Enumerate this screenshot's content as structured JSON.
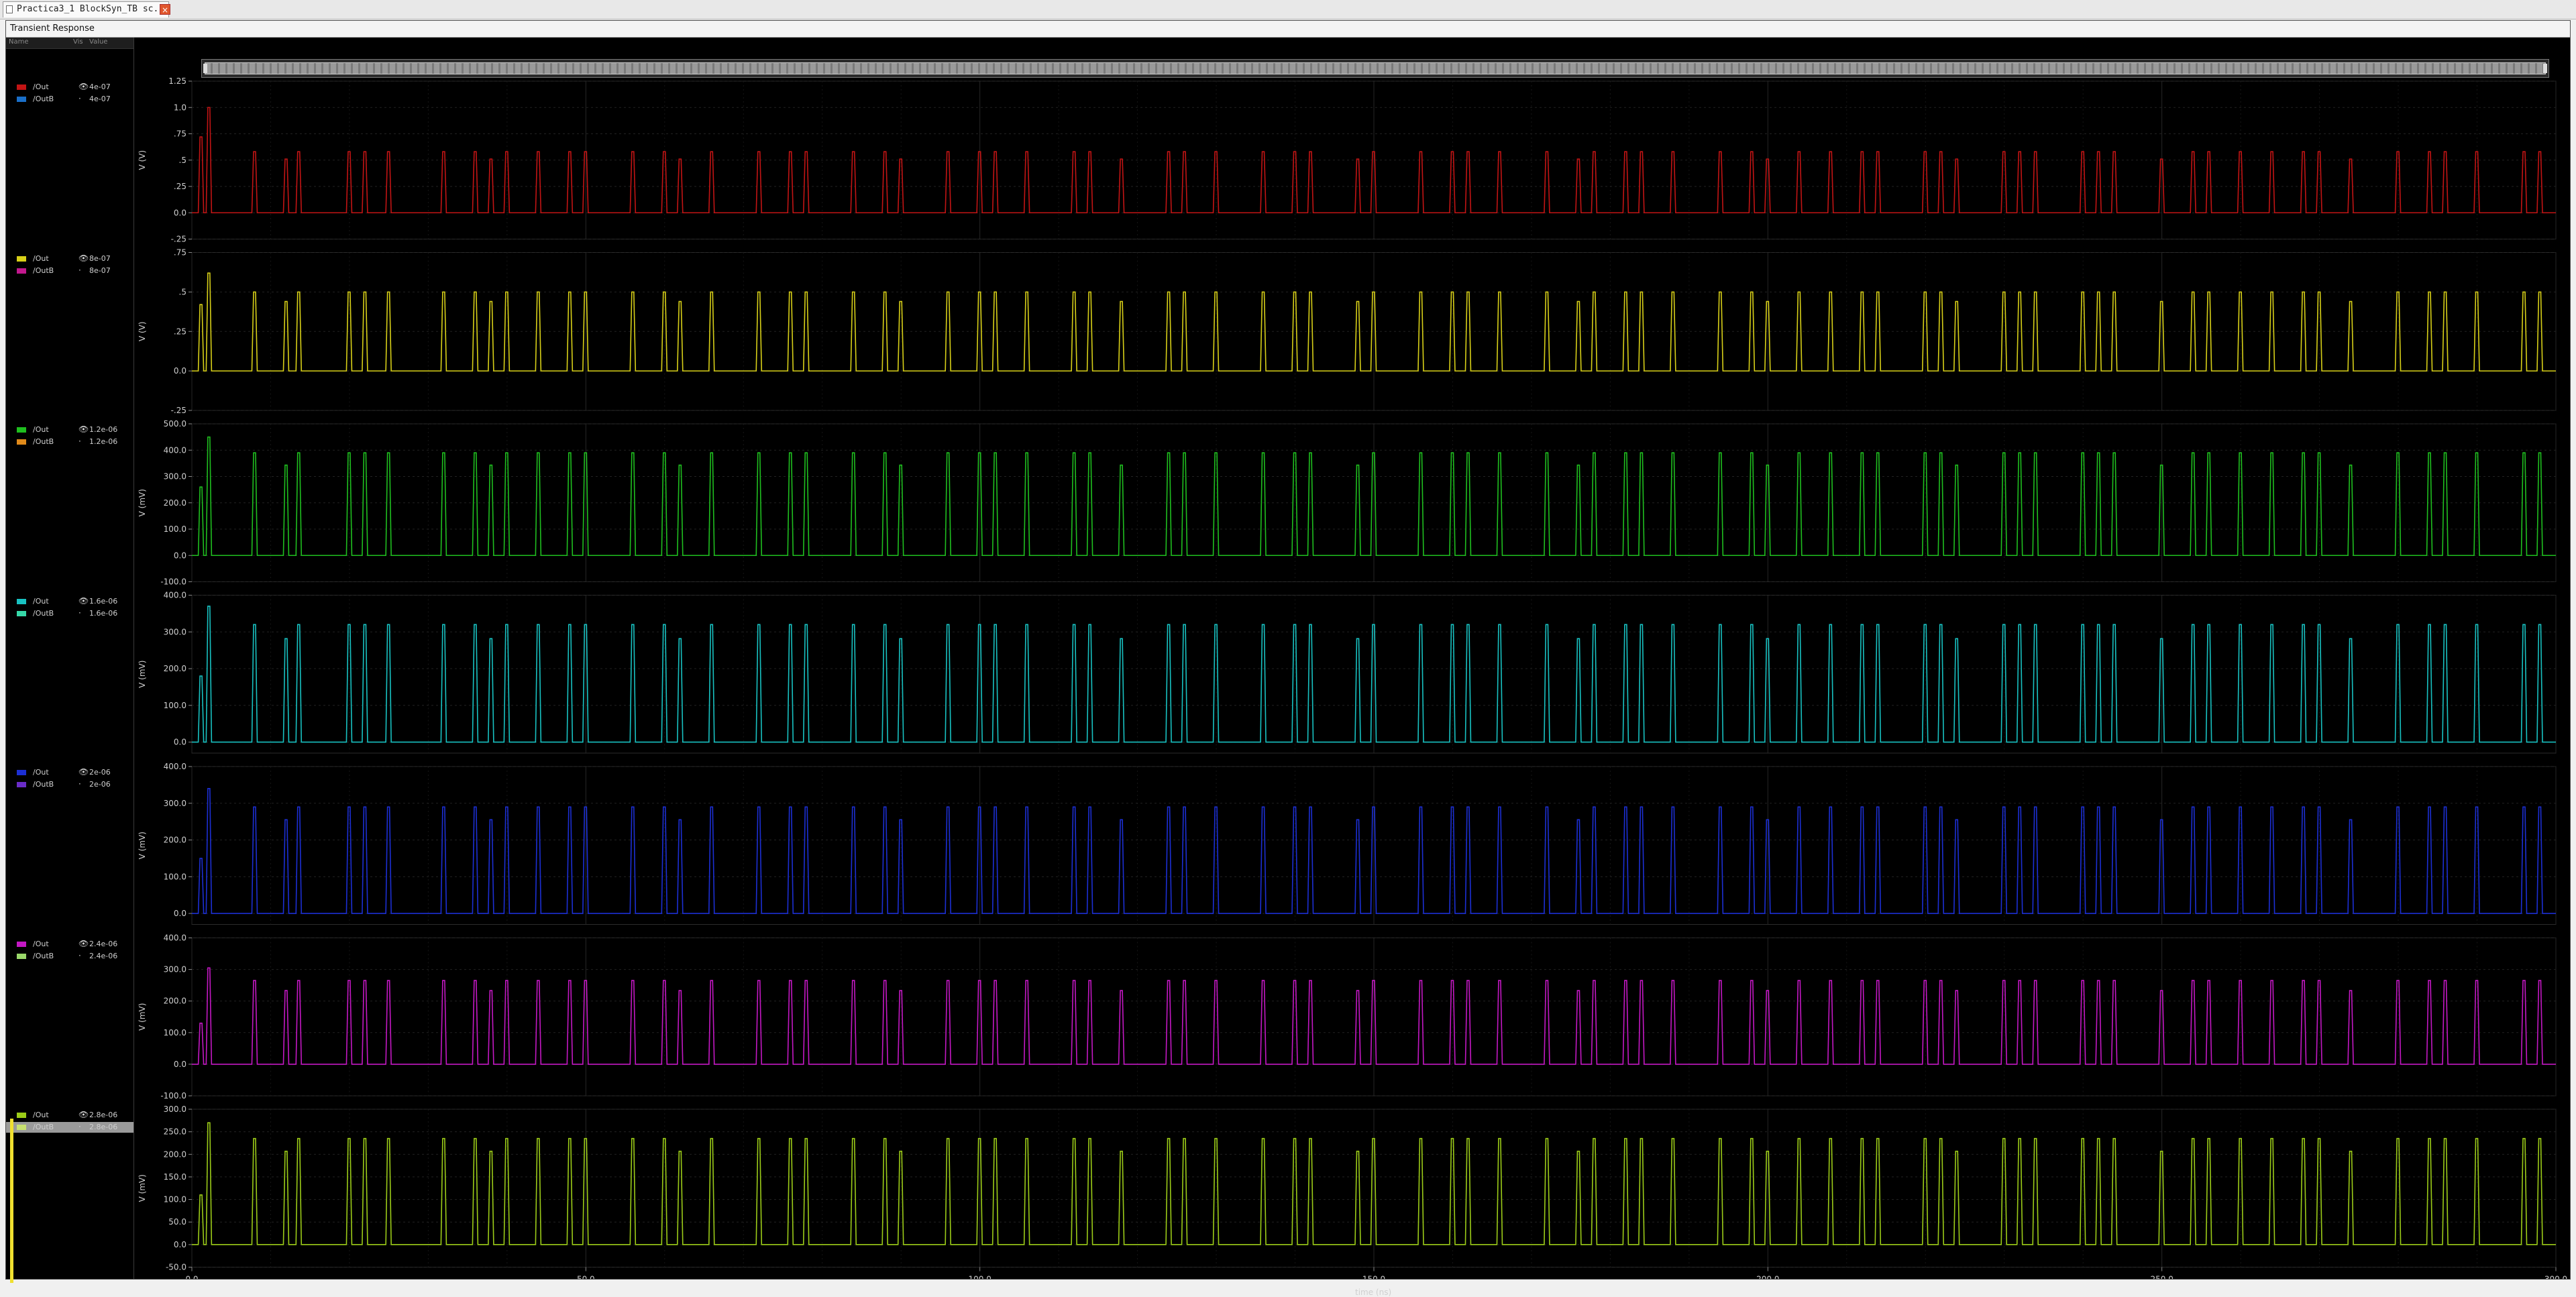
{
  "tab": {
    "label": "Practica3_1 BlockSyn_TB sc...",
    "close_glyph": "×"
  },
  "window": {
    "title": "Transient Response"
  },
  "legend_header": {
    "name_col": "Name",
    "vis_col": "Vis",
    "value_col": "Value"
  },
  "panels": [
    {
      "color": "#c21414",
      "traces": [
        {
          "name": "/Out",
          "value": "4e-07",
          "color": "#c21414",
          "eye": true
        },
        {
          "name": "/OutB",
          "value": "4e-07",
          "color": "#1a6fc9",
          "eye": false
        }
      ],
      "yunit": "V (V)",
      "ylim": [
        -0.25,
        1.25
      ],
      "yticks": [
        "1.25",
        "1.0",
        ".75",
        ".5",
        ".25",
        "0.0",
        "-.25"
      ],
      "tickvals": [
        1.25,
        1.0,
        0.75,
        0.5,
        0.25,
        0.0,
        -0.25
      ],
      "peak": 0.58,
      "first_peaks": [
        0.72,
        1.0
      ]
    },
    {
      "color": "#d8d018",
      "traces": [
        {
          "name": "/Out",
          "value": "8e-07",
          "color": "#d8d018",
          "eye": true
        },
        {
          "name": "/OutB",
          "value": "8e-07",
          "color": "#c2188e",
          "eye": false
        }
      ],
      "yunit": "V (V)",
      "ylim": [
        -0.25,
        0.75
      ],
      "yticks": [
        ".75",
        ".5",
        ".25",
        "0.0",
        "-.25"
      ],
      "tickvals": [
        0.75,
        0.5,
        0.25,
        0.0,
        -0.25
      ],
      "peak": 0.5,
      "first_peaks": [
        0.42,
        0.62
      ]
    },
    {
      "color": "#1fbf1f",
      "traces": [
        {
          "name": "/Out",
          "value": "1.2e-06",
          "color": "#1fbf1f",
          "eye": true
        },
        {
          "name": "/OutB",
          "value": "1.2e-06",
          "color": "#e08a1a",
          "eye": false
        }
      ],
      "yunit": "V (mV)",
      "ylim": [
        -100,
        500
      ],
      "yticks": [
        "500.0",
        "400.0",
        "300.0",
        "200.0",
        "100.0",
        "0.0",
        "-100.0"
      ],
      "tickvals": [
        500,
        400,
        300,
        200,
        100,
        0,
        -100
      ],
      "peak": 390,
      "first_peaks": [
        260,
        450
      ]
    },
    {
      "color": "#18c2c2",
      "traces": [
        {
          "name": "/Out",
          "value": "1.6e-06",
          "color": "#18c2c2",
          "eye": true
        },
        {
          "name": "/OutB",
          "value": "1.6e-06",
          "color": "#36d8a8",
          "eye": false
        }
      ],
      "yunit": "V (mV)",
      "ylim": [
        -30,
        400
      ],
      "yticks": [
        "400.0",
        "300.0",
        "200.0",
        "100.0",
        "0.0"
      ],
      "tickvals": [
        400,
        300,
        200,
        100,
        0
      ],
      "peak": 320,
      "first_peaks": [
        180,
        370
      ]
    },
    {
      "color": "#1c2fd4",
      "traces": [
        {
          "name": "/Out",
          "value": "2e-06",
          "color": "#1c2fd4",
          "eye": true
        },
        {
          "name": "/OutB",
          "value": "2e-06",
          "color": "#6a2cc8",
          "eye": false
        }
      ],
      "yunit": "V (mV)",
      "ylim": [
        -30,
        400
      ],
      "yticks": [
        "400.0",
        "300.0",
        "200.0",
        "100.0",
        "0.0"
      ],
      "tickvals": [
        400,
        300,
        200,
        100,
        0
      ],
      "peak": 290,
      "first_peaks": [
        150,
        340
      ]
    },
    {
      "color": "#c418c4",
      "traces": [
        {
          "name": "/Out",
          "value": "2.4e-06",
          "color": "#c418c4",
          "eye": true
        },
        {
          "name": "/OutB",
          "value": "2.4e-06",
          "color": "#9ad86a",
          "eye": false
        }
      ],
      "yunit": "V (mV)",
      "ylim": [
        -100,
        400
      ],
      "yticks": [
        "400.0",
        "300.0",
        "200.0",
        "100.0",
        "0.0",
        "-100.0"
      ],
      "tickvals": [
        400,
        300,
        200,
        100,
        0,
        -100
      ],
      "peak": 265,
      "first_peaks": [
        130,
        305
      ]
    },
    {
      "color": "#9ccc18",
      "traces": [
        {
          "name": "/Out",
          "value": "2.8e-06",
          "color": "#9ccc18",
          "eye": true
        },
        {
          "name": "/OutB",
          "value": "2.8e-06",
          "color": "#c8e070",
          "eye": false,
          "selected": true
        }
      ],
      "yunit": "V (mV)",
      "ylim": [
        -50,
        300
      ],
      "yticks": [
        "300.0",
        "250.0",
        "200.0",
        "150.0",
        "100.0",
        "50.0",
        "0.0",
        "-50.0"
      ],
      "tickvals": [
        300,
        250,
        200,
        150,
        100,
        50,
        0,
        -50
      ],
      "peak": 235,
      "first_peaks": [
        110,
        270
      ]
    }
  ],
  "chart_data": {
    "type": "line",
    "title": "Transient Response",
    "xlabel": "time (ns)",
    "xlim": [
      0,
      300
    ],
    "xticks": [
      "0.0",
      "50.0",
      "100.0",
      "150.0",
      "200.0",
      "250.0",
      "300.0"
    ],
    "xtickvals": [
      0,
      50,
      100,
      150,
      200,
      250,
      300
    ],
    "grid": true,
    "pulse_times_ns": [
      1.2,
      2.2,
      8,
      12,
      13.6,
      20,
      22,
      25,
      32,
      36,
      38,
      40,
      44,
      48,
      50,
      56,
      60,
      62,
      66,
      72,
      76,
      78,
      84,
      88,
      90,
      96,
      100,
      102,
      106,
      112,
      114,
      118,
      124,
      126,
      130,
      136,
      140,
      142,
      148,
      150,
      156,
      160,
      162,
      166,
      172,
      176,
      178,
      182,
      184,
      188,
      194,
      198,
      200,
      204,
      208,
      212,
      214,
      220,
      222,
      224,
      230,
      232,
      234,
      240,
      242,
      244,
      250,
      254,
      256,
      260,
      264,
      268,
      270,
      274,
      280,
      284,
      286,
      290,
      296,
      298
    ]
  }
}
